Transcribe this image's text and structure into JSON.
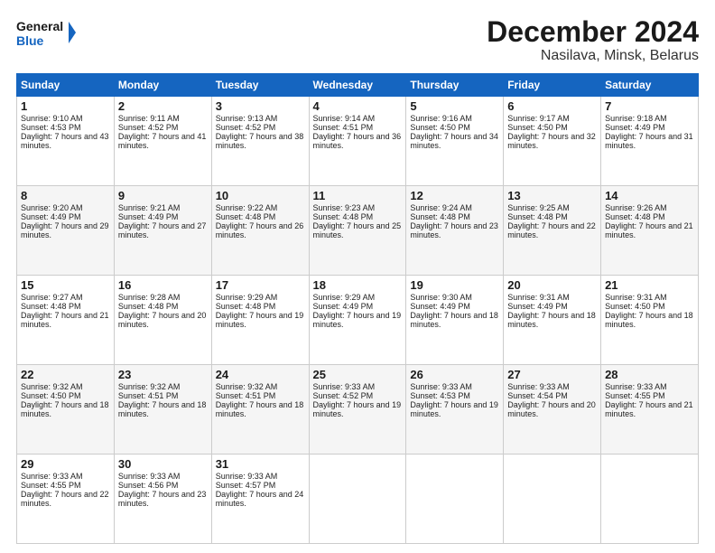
{
  "header": {
    "logo_line1": "General",
    "logo_line2": "Blue",
    "title": "December 2024",
    "subtitle": "Nasilava, Minsk, Belarus"
  },
  "calendar": {
    "columns": [
      "Sunday",
      "Monday",
      "Tuesday",
      "Wednesday",
      "Thursday",
      "Friday",
      "Saturday"
    ],
    "rows": [
      [
        {
          "day": "1",
          "sunrise": "9:10 AM",
          "sunset": "4:53 PM",
          "daylight": "7 hours and 43 minutes."
        },
        {
          "day": "2",
          "sunrise": "9:11 AM",
          "sunset": "4:52 PM",
          "daylight": "7 hours and 41 minutes."
        },
        {
          "day": "3",
          "sunrise": "9:13 AM",
          "sunset": "4:52 PM",
          "daylight": "7 hours and 38 minutes."
        },
        {
          "day": "4",
          "sunrise": "9:14 AM",
          "sunset": "4:51 PM",
          "daylight": "7 hours and 36 minutes."
        },
        {
          "day": "5",
          "sunrise": "9:16 AM",
          "sunset": "4:50 PM",
          "daylight": "7 hours and 34 minutes."
        },
        {
          "day": "6",
          "sunrise": "9:17 AM",
          "sunset": "4:50 PM",
          "daylight": "7 hours and 32 minutes."
        },
        {
          "day": "7",
          "sunrise": "9:18 AM",
          "sunset": "4:49 PM",
          "daylight": "7 hours and 31 minutes."
        }
      ],
      [
        {
          "day": "8",
          "sunrise": "9:20 AM",
          "sunset": "4:49 PM",
          "daylight": "7 hours and 29 minutes."
        },
        {
          "day": "9",
          "sunrise": "9:21 AM",
          "sunset": "4:49 PM",
          "daylight": "7 hours and 27 minutes."
        },
        {
          "day": "10",
          "sunrise": "9:22 AM",
          "sunset": "4:48 PM",
          "daylight": "7 hours and 26 minutes."
        },
        {
          "day": "11",
          "sunrise": "9:23 AM",
          "sunset": "4:48 PM",
          "daylight": "7 hours and 25 minutes."
        },
        {
          "day": "12",
          "sunrise": "9:24 AM",
          "sunset": "4:48 PM",
          "daylight": "7 hours and 23 minutes."
        },
        {
          "day": "13",
          "sunrise": "9:25 AM",
          "sunset": "4:48 PM",
          "daylight": "7 hours and 22 minutes."
        },
        {
          "day": "14",
          "sunrise": "9:26 AM",
          "sunset": "4:48 PM",
          "daylight": "7 hours and 21 minutes."
        }
      ],
      [
        {
          "day": "15",
          "sunrise": "9:27 AM",
          "sunset": "4:48 PM",
          "daylight": "7 hours and 21 minutes."
        },
        {
          "day": "16",
          "sunrise": "9:28 AM",
          "sunset": "4:48 PM",
          "daylight": "7 hours and 20 minutes."
        },
        {
          "day": "17",
          "sunrise": "9:29 AM",
          "sunset": "4:48 PM",
          "daylight": "7 hours and 19 minutes."
        },
        {
          "day": "18",
          "sunrise": "9:29 AM",
          "sunset": "4:49 PM",
          "daylight": "7 hours and 19 minutes."
        },
        {
          "day": "19",
          "sunrise": "9:30 AM",
          "sunset": "4:49 PM",
          "daylight": "7 hours and 18 minutes."
        },
        {
          "day": "20",
          "sunrise": "9:31 AM",
          "sunset": "4:49 PM",
          "daylight": "7 hours and 18 minutes."
        },
        {
          "day": "21",
          "sunrise": "9:31 AM",
          "sunset": "4:50 PM",
          "daylight": "7 hours and 18 minutes."
        }
      ],
      [
        {
          "day": "22",
          "sunrise": "9:32 AM",
          "sunset": "4:50 PM",
          "daylight": "7 hours and 18 minutes."
        },
        {
          "day": "23",
          "sunrise": "9:32 AM",
          "sunset": "4:51 PM",
          "daylight": "7 hours and 18 minutes."
        },
        {
          "day": "24",
          "sunrise": "9:32 AM",
          "sunset": "4:51 PM",
          "daylight": "7 hours and 18 minutes."
        },
        {
          "day": "25",
          "sunrise": "9:33 AM",
          "sunset": "4:52 PM",
          "daylight": "7 hours and 19 minutes."
        },
        {
          "day": "26",
          "sunrise": "9:33 AM",
          "sunset": "4:53 PM",
          "daylight": "7 hours and 19 minutes."
        },
        {
          "day": "27",
          "sunrise": "9:33 AM",
          "sunset": "4:54 PM",
          "daylight": "7 hours and 20 minutes."
        },
        {
          "day": "28",
          "sunrise": "9:33 AM",
          "sunset": "4:55 PM",
          "daylight": "7 hours and 21 minutes."
        }
      ],
      [
        {
          "day": "29",
          "sunrise": "9:33 AM",
          "sunset": "4:55 PM",
          "daylight": "7 hours and 22 minutes."
        },
        {
          "day": "30",
          "sunrise": "9:33 AM",
          "sunset": "4:56 PM",
          "daylight": "7 hours and 23 minutes."
        },
        {
          "day": "31",
          "sunrise": "9:33 AM",
          "sunset": "4:57 PM",
          "daylight": "7 hours and 24 minutes."
        },
        null,
        null,
        null,
        null
      ]
    ]
  }
}
